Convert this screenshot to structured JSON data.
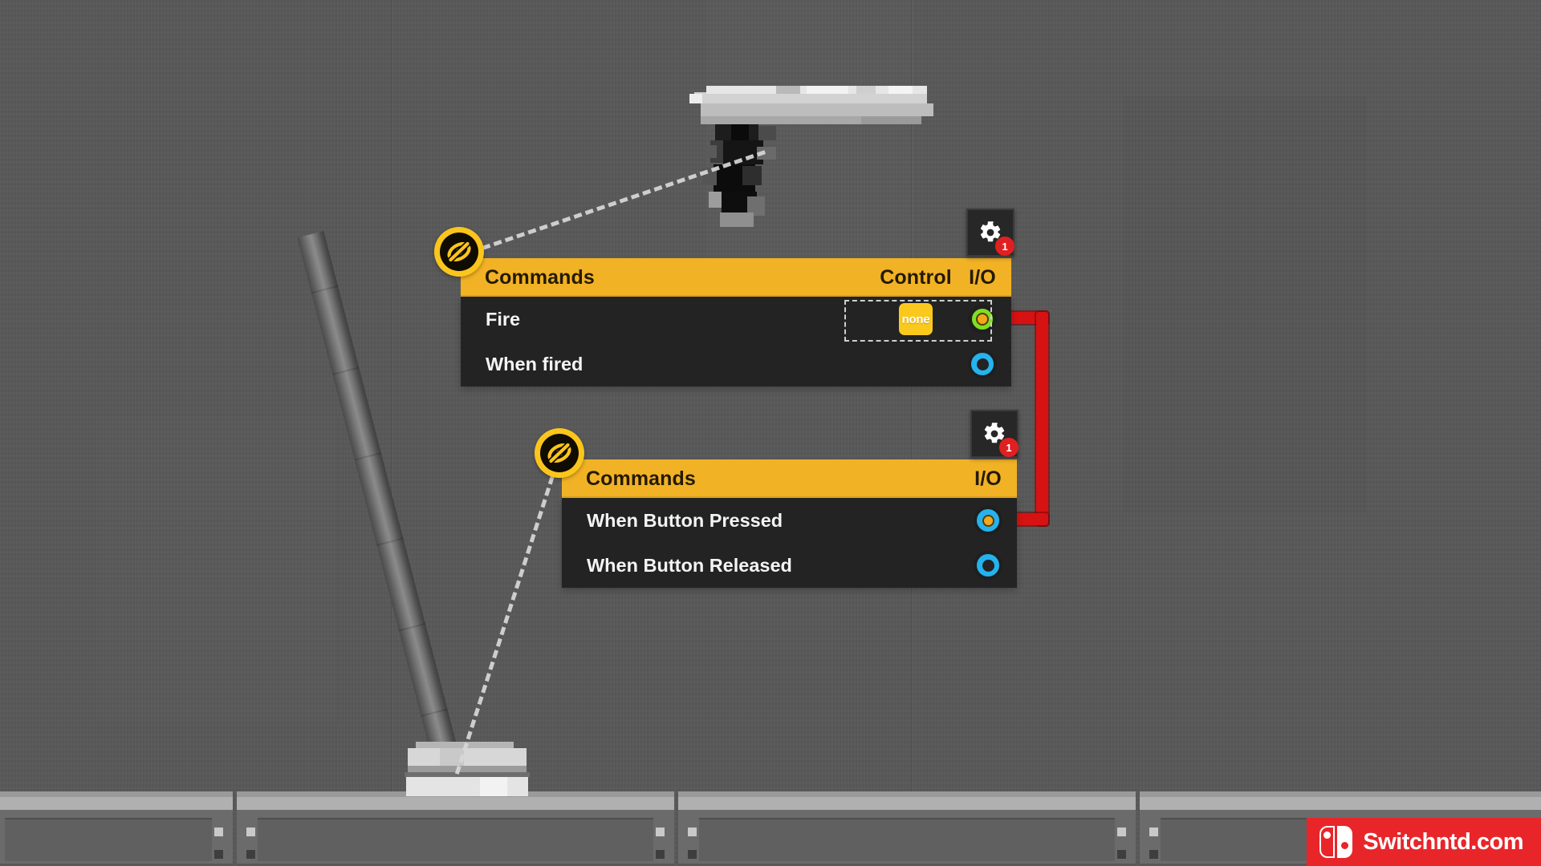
{
  "colors": {
    "background": "#585858",
    "panel_header": "#f2b225",
    "panel_body": "#232323",
    "accent_yellow": "#fbc51c",
    "wire_red": "#d61212",
    "port_green": "#7ee021",
    "port_blue": "#24b3ee",
    "port_core_orange": "#f0a81c",
    "badge_red": "#e02020",
    "watermark_red": "#e8262a",
    "text_light": "#f4f4f4",
    "text_dark": "#241a03"
  },
  "panels": [
    {
      "id": "weapon-panel",
      "title": "Commands",
      "columns": [
        "Control",
        "I/O"
      ],
      "gear": {
        "icon": "gear-icon",
        "badge_count": "1"
      },
      "visibility": {
        "icon": "visibility-off-icon",
        "state": "hidden"
      },
      "rows": [
        {
          "label": "Fire",
          "control": {
            "type": "chip",
            "value": "none"
          },
          "io": {
            "type": "port",
            "style": "green-filled",
            "connected": true
          },
          "selected": true
        },
        {
          "label": "When fired",
          "control": null,
          "io": {
            "type": "port",
            "style": "blue-open",
            "connected": false
          },
          "selected": false
        }
      ]
    },
    {
      "id": "button-panel",
      "title": "Commands",
      "columns": [
        "I/O"
      ],
      "gear": {
        "icon": "gear-icon",
        "badge_count": "1"
      },
      "visibility": {
        "icon": "visibility-off-icon",
        "state": "hidden"
      },
      "rows": [
        {
          "label": "When Button Pressed",
          "control": null,
          "io": {
            "type": "port",
            "style": "blue-filled",
            "connected": true
          },
          "selected": false
        },
        {
          "label": "When Button Released",
          "control": null,
          "io": {
            "type": "port",
            "style": "blue-open",
            "connected": false
          },
          "selected": false
        }
      ]
    }
  ],
  "wire": {
    "name": "signal-wire",
    "color": "#d61212",
    "from": "weapon-panel.Fire.io",
    "to": "button-panel.When Button Pressed.io"
  },
  "scene": {
    "objects": [
      {
        "name": "pistol-sprite",
        "label": "Pistol"
      },
      {
        "name": "button-pedestal-sprite",
        "label": "Button"
      },
      {
        "name": "support-pole",
        "label": "Pole"
      }
    ]
  },
  "watermark": {
    "text": "Switchntd.com",
    "logo": "nintendo-switch-logo"
  }
}
